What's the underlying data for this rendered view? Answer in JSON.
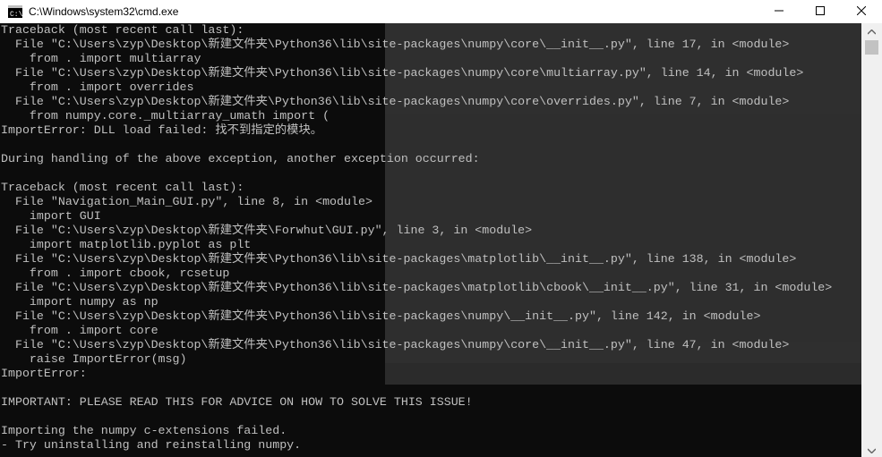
{
  "window": {
    "title": "C:\\Windows\\system32\\cmd.exe"
  },
  "console": {
    "lines": [
      "Traceback (most recent call last):",
      "  File \"C:\\Users\\zyp\\Desktop\\新建文件夹\\Python36\\lib\\site-packages\\numpy\\core\\__init__.py\", line 17, in <module>",
      "    from . import multiarray",
      "  File \"C:\\Users\\zyp\\Desktop\\新建文件夹\\Python36\\lib\\site-packages\\numpy\\core\\multiarray.py\", line 14, in <module>",
      "    from . import overrides",
      "  File \"C:\\Users\\zyp\\Desktop\\新建文件夹\\Python36\\lib\\site-packages\\numpy\\core\\overrides.py\", line 7, in <module>",
      "    from numpy.core._multiarray_umath import (",
      "ImportError: DLL load failed: 找不到指定的模块。",
      "",
      "During handling of the above exception, another exception occurred:",
      "",
      "Traceback (most recent call last):",
      "  File \"Navigation_Main_GUI.py\", line 8, in <module>",
      "    import GUI",
      "  File \"C:\\Users\\zyp\\Desktop\\新建文件夹\\Forwhut\\GUI.py\", line 3, in <module>",
      "    import matplotlib.pyplot as plt",
      "  File \"C:\\Users\\zyp\\Desktop\\新建文件夹\\Python36\\lib\\site-packages\\matplotlib\\__init__.py\", line 138, in <module>",
      "    from . import cbook, rcsetup",
      "  File \"C:\\Users\\zyp\\Desktop\\新建文件夹\\Python36\\lib\\site-packages\\matplotlib\\cbook\\__init__.py\", line 31, in <module>",
      "    import numpy as np",
      "  File \"C:\\Users\\zyp\\Desktop\\新建文件夹\\Python36\\lib\\site-packages\\numpy\\__init__.py\", line 142, in <module>",
      "    from . import core",
      "  File \"C:\\Users\\zyp\\Desktop\\新建文件夹\\Python36\\lib\\site-packages\\numpy\\core\\__init__.py\", line 47, in <module>",
      "    raise ImportError(msg)",
      "ImportError:",
      "",
      "IMPORTANT: PLEASE READ THIS FOR ADVICE ON HOW TO SOLVE THIS ISSUE!",
      "",
      "Importing the numpy c-extensions failed.",
      "- Try uninstalling and reinstalling numpy."
    ]
  },
  "icons": {
    "app": "cmd-icon",
    "minimize": "minimize-icon",
    "maximize": "maximize-icon",
    "close": "close-icon",
    "scroll_up": "chevron-up-icon",
    "scroll_down": "chevron-down-icon"
  },
  "colors": {
    "console_bg": "#0c0c0c",
    "console_text": "#c0c0c0",
    "titlebar_bg": "#ffffff",
    "scrollbar_bg": "#f0f0f0"
  }
}
